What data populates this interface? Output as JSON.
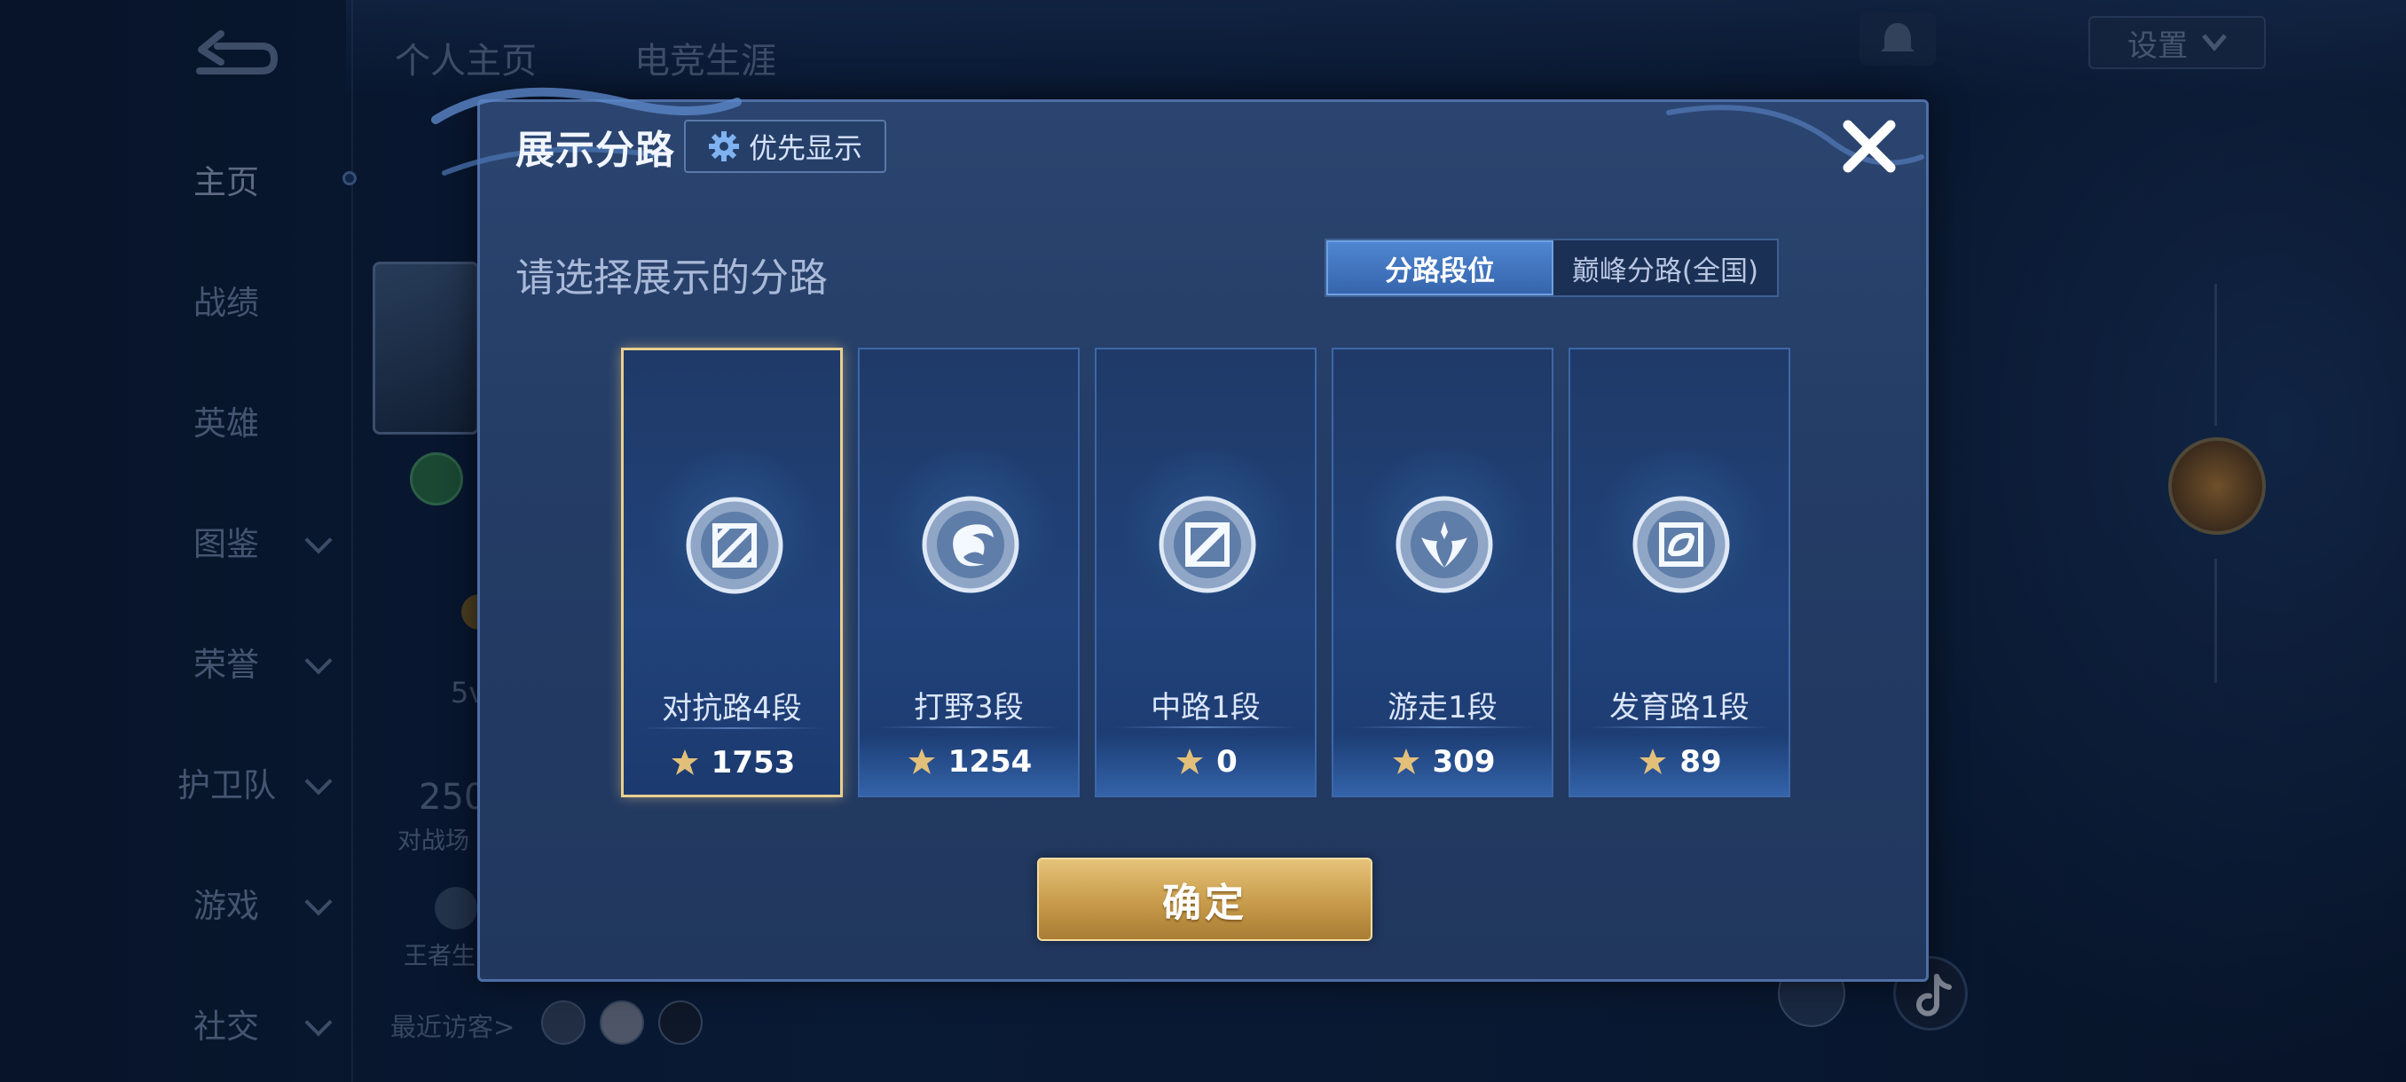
{
  "background": {
    "nav_tabs": [
      "个人主页",
      "电竞生涯"
    ],
    "sidebar": [
      {
        "label": "主页",
        "active": true,
        "expandable": false
      },
      {
        "label": "战绩",
        "active": false,
        "expandable": false
      },
      {
        "label": "英雄",
        "active": false,
        "expandable": false
      },
      {
        "label": "图鉴",
        "active": false,
        "expandable": true
      },
      {
        "label": "荣誉",
        "active": false,
        "expandable": true
      },
      {
        "label": "护卫队",
        "active": false,
        "expandable": true
      },
      {
        "label": "游戏",
        "active": false,
        "expandable": true
      },
      {
        "label": "社交",
        "active": false,
        "expandable": true
      }
    ],
    "settings_label": "设置",
    "stat_partial_1": "5v",
    "stat_partial_2": "250",
    "stat_partial_3": "对战场",
    "stat_partial_4": "王者生",
    "recent_visitors": "最近访客>"
  },
  "modal": {
    "title": "展示分路",
    "pref_button": "优先显示",
    "subtitle": "请选择展示的分路",
    "segment": {
      "options": [
        "分路段位",
        "巅峰分路(全国)"
      ],
      "selected": 0
    },
    "lanes": [
      {
        "name": "对抗路4段",
        "score": "1753",
        "emblem": "clash-lane-emblem-icon",
        "selected": true
      },
      {
        "name": "打野3段",
        "score": "1254",
        "emblem": "jungle-emblem-icon",
        "selected": false
      },
      {
        "name": "中路1段",
        "score": "0",
        "emblem": "mid-lane-emblem-icon",
        "selected": false
      },
      {
        "name": "游走1段",
        "score": "309",
        "emblem": "roam-emblem-icon",
        "selected": false
      },
      {
        "name": "发育路1段",
        "score": "89",
        "emblem": "farm-lane-emblem-icon",
        "selected": false
      }
    ],
    "confirm_button": "确定"
  },
  "colors": {
    "accent_blue": "#3565ad",
    "gold": "#c79b4a",
    "selected_border": "#e9cf8e"
  }
}
